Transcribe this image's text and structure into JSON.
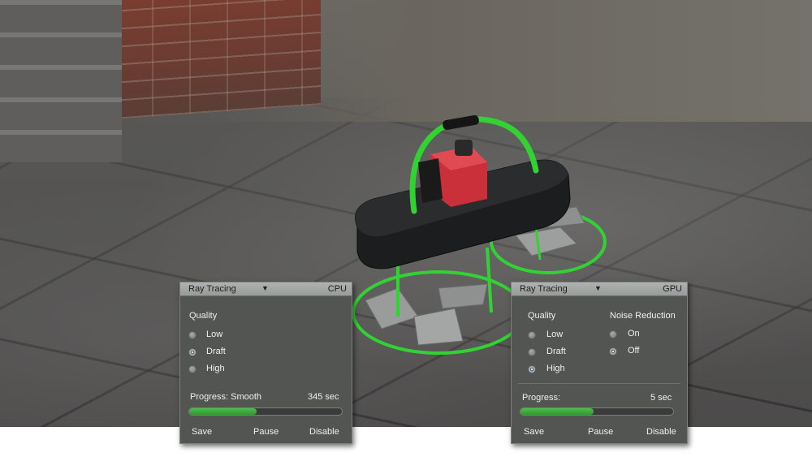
{
  "cpu_panel": {
    "mode": "Ray Tracing",
    "device": "CPU",
    "quality_label": "Quality",
    "options": [
      {
        "label": "Low",
        "selected": false
      },
      {
        "label": "Draft",
        "selected": true
      },
      {
        "label": "High",
        "selected": false
      }
    ],
    "progress_label": "Progress: Smooth",
    "progress_time": "345 sec",
    "progress_fraction": 0.44,
    "actions": {
      "save": "Save",
      "pause": "Pause",
      "disable": "Disable"
    }
  },
  "gpu_panel": {
    "mode": "Ray Tracing",
    "device": "GPU",
    "quality_label": "Quality",
    "options": [
      {
        "label": "Low",
        "selected": false
      },
      {
        "label": "Draft",
        "selected": false
      },
      {
        "label": "High",
        "selected": true
      }
    ],
    "noise_label": "Noise Reduction",
    "noise_options": [
      {
        "label": "On",
        "selected": false
      },
      {
        "label": "Off",
        "selected": true
      }
    ],
    "progress_label": "Progress:",
    "progress_time": "5 sec",
    "progress_fraction": 0.48,
    "actions": {
      "save": "Save",
      "pause": "Pause",
      "disable": "Disable"
    }
  },
  "colors": {
    "accent_green": "#3fb83f",
    "panel_bg": "#535553",
    "header_bg": "#a3a7a6"
  },
  "icons": {
    "dropdown": "caret-down-icon",
    "radio": "radio-icon"
  }
}
